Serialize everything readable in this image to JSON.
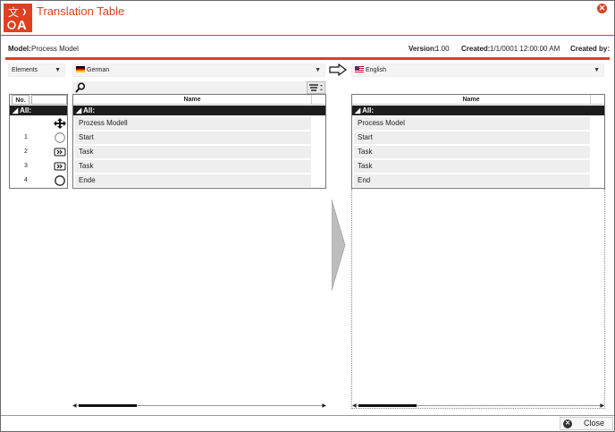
{
  "window": {
    "title": "Translation Table",
    "accent": "#d9421f"
  },
  "info": {
    "model_label": "Model:",
    "model_value": "Process Model",
    "version_label": "Version:",
    "version_value": "1.00",
    "created_label": "Created:",
    "created_value": "1/1/0001 12:00:00 AM",
    "created_by_label": "Created by:"
  },
  "selectors": {
    "type": "Elements",
    "source_language": "German",
    "target_language": "English"
  },
  "left_index": {
    "headers": [
      "No.",
      ""
    ],
    "all_label": "All:",
    "rows": [
      {
        "no": "",
        "icon": "process-model-icon"
      },
      {
        "no": "1",
        "icon": "start-event-icon"
      },
      {
        "no": "2",
        "icon": "task-icon"
      },
      {
        "no": "3",
        "icon": "task-icon"
      },
      {
        "no": "4",
        "icon": "end-event-icon"
      }
    ]
  },
  "source_table": {
    "header": "Name",
    "all_label": "All:",
    "rows": [
      "Prozess Modell",
      "Start",
      "Task",
      "Task",
      "Ende"
    ]
  },
  "target_table": {
    "header": "Name",
    "all_label": "All:",
    "rows": [
      "Process Model",
      "Start",
      "Task",
      "Task",
      "End"
    ]
  },
  "footer": {
    "close_label": "Close"
  }
}
